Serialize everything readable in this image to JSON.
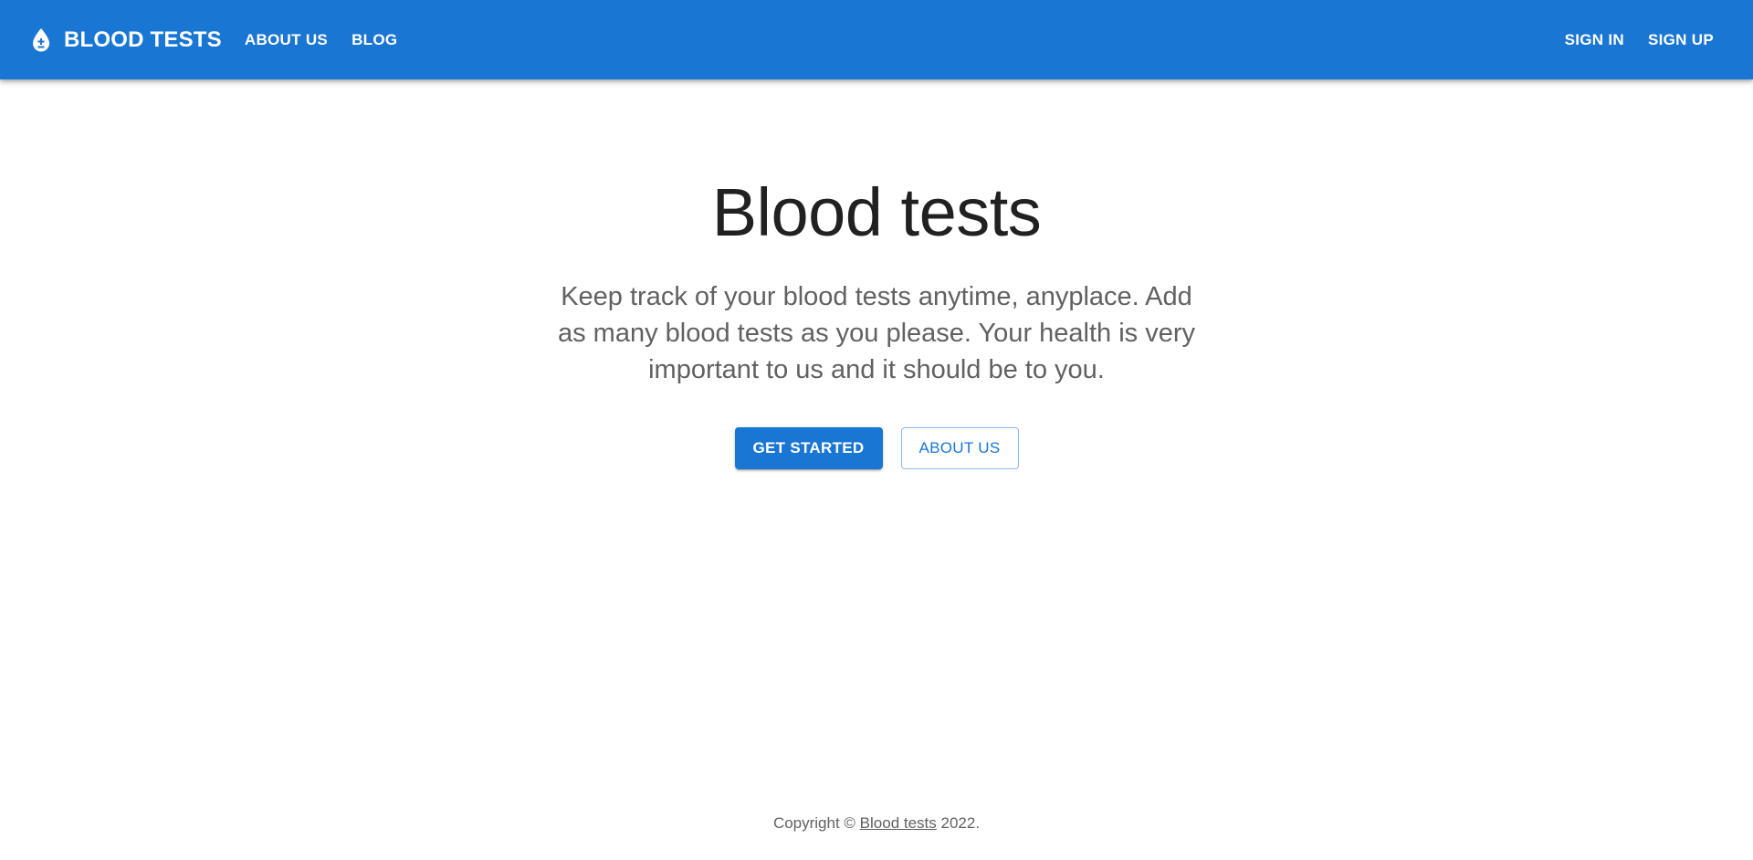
{
  "header": {
    "brand": "BLOOD TESTS",
    "brand_icon": "blood-drop-icon",
    "nav": [
      {
        "label": "ABOUT US"
      },
      {
        "label": "BLOG"
      }
    ],
    "auth": [
      {
        "label": "SIGN IN"
      },
      {
        "label": "SIGN UP"
      }
    ]
  },
  "hero": {
    "title": "Blood tests",
    "description": "Keep track of your blood tests anytime, anyplace. Add as many blood tests as you please. Your health is very important to us and it should be to you.",
    "primary_button": "GET STARTED",
    "secondary_button": "ABOUT US"
  },
  "footer": {
    "prefix": "Copyright © ",
    "link": "Blood tests",
    "suffix": " 2022."
  },
  "colors": {
    "primary": "#1976d2",
    "text_primary": "#212121",
    "text_secondary": "#616161",
    "background": "#ffffff"
  }
}
